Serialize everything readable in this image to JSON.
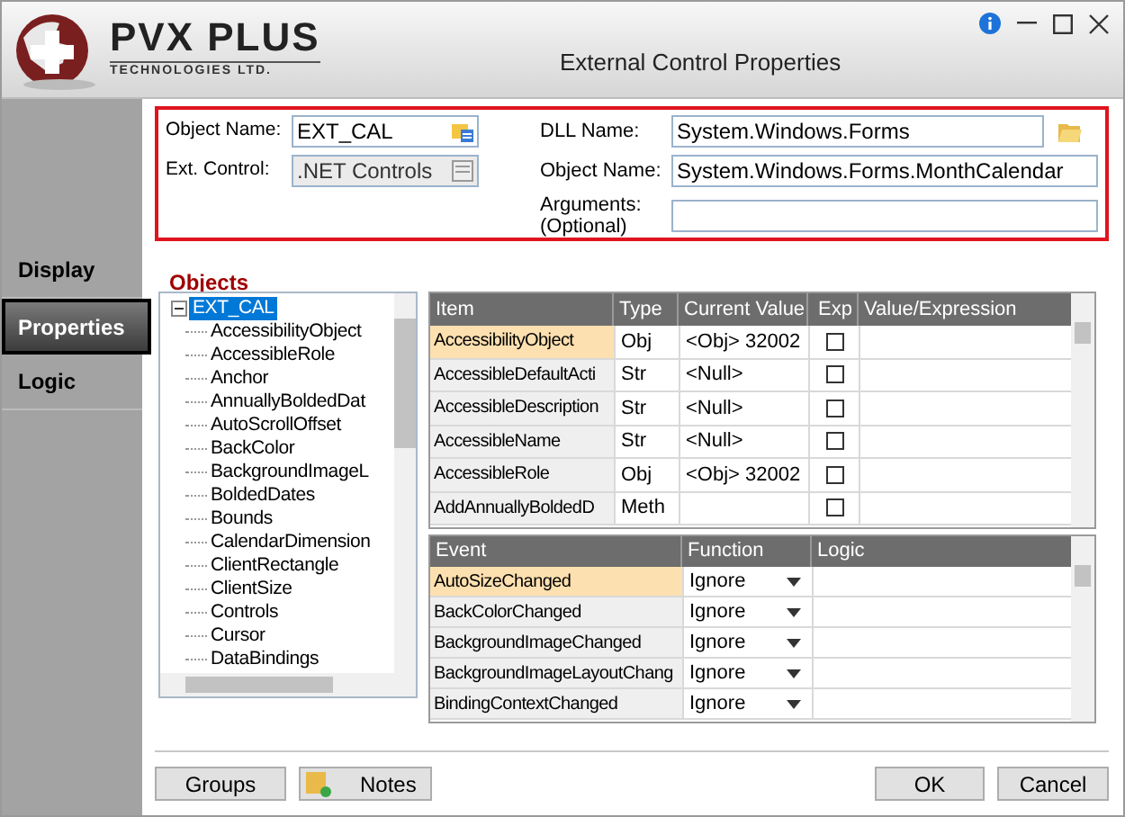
{
  "window": {
    "logo_title": "PVX PLUS",
    "logo_subtitle": "TECHNOLOGIES LTD.",
    "title": "External Control Properties"
  },
  "fields": {
    "object_name": {
      "label": "Object Name:",
      "value": "EXT_CAL"
    },
    "ext_control": {
      "label": "Ext. Control:",
      "value": ".NET Controls",
      "disabled": true
    },
    "dll_name": {
      "label": "DLL Name:",
      "value": "System.Windows.Forms"
    },
    "net_object_name": {
      "label": "Object Name:",
      "value": "System.Windows.Forms.MonthCalendar"
    },
    "arguments": {
      "label": "Arguments:\n(Optional)"
    }
  },
  "sidebar": {
    "items": [
      {
        "label": "Display",
        "selected": false
      },
      {
        "label": "Properties",
        "selected": true
      },
      {
        "label": "Logic",
        "selected": false
      }
    ]
  },
  "objects": {
    "heading": "Objects",
    "tree": [
      {
        "label": "EXT_CAL",
        "selected": true,
        "expanded": true,
        "children": [
          {
            "label": "AccessibilityObject"
          },
          {
            "label": "AccessibleRole"
          },
          {
            "label": "Anchor"
          },
          {
            "label": "AnnuallyBoldedDat"
          },
          {
            "label": "AutoScrollOffset"
          },
          {
            "label": "BackColor"
          },
          {
            "label": "BackgroundImageL"
          },
          {
            "label": "BoldedDates"
          },
          {
            "label": "Bounds"
          },
          {
            "label": "CalendarDimension"
          },
          {
            "label": "ClientRectangle"
          },
          {
            "label": "ClientSize"
          },
          {
            "label": "Controls"
          },
          {
            "label": "Cursor"
          },
          {
            "label": "DataBindings"
          }
        ]
      }
    ]
  },
  "properties_table": {
    "columns": [
      "Item",
      "Type",
      "Current Value",
      "Exp",
      "Value/Expression"
    ],
    "rows": [
      {
        "item": "AccessibilityObject",
        "type": "Obj",
        "current_value": "<Obj> 32002",
        "exp": false,
        "selected": true
      },
      {
        "item": "AccessibleDefaultActi",
        "type": "Str",
        "current_value": "<Null>",
        "exp": false,
        "selected": false
      },
      {
        "item": "AccessibleDescription",
        "type": "Str",
        "current_value": "<Null>",
        "exp": false,
        "selected": false
      },
      {
        "item": "AccessibleName",
        "type": "Str",
        "current_value": "<Null>",
        "exp": false,
        "selected": false
      },
      {
        "item": "AccessibleRole",
        "type": "Obj",
        "current_value": "<Obj> 32002",
        "exp": false,
        "selected": false
      },
      {
        "item": "AddAnnuallyBoldedD",
        "type": "Meth",
        "current_value": "",
        "exp": false,
        "selected": false
      }
    ]
  },
  "events_table": {
    "columns": [
      "Event",
      "Function",
      "Logic"
    ],
    "rows": [
      {
        "event": "AutoSizeChanged",
        "function": "Ignore",
        "selected": true
      },
      {
        "event": "BackColorChanged",
        "function": "Ignore",
        "selected": false
      },
      {
        "event": "BackgroundImageChanged",
        "function": "Ignore",
        "selected": false
      },
      {
        "event": "BackgroundImageLayoutChang",
        "function": "Ignore",
        "selected": false
      },
      {
        "event": "BindingContextChanged",
        "function": "Ignore",
        "selected": false
      }
    ]
  },
  "buttons": {
    "groups": "Groups",
    "notes": "Notes",
    "ok": "OK",
    "cancel": "Cancel"
  }
}
